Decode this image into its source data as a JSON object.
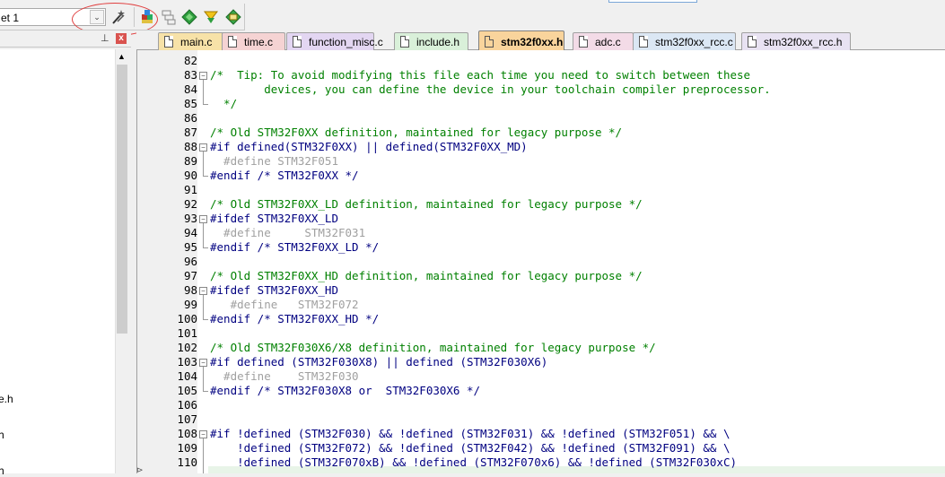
{
  "toolbar": {
    "target_name": "et 1",
    "target_dropdown": "⌄",
    "buttons": [
      {
        "name": "target-options-icon"
      },
      {
        "name": "manage-project-items-icon"
      },
      {
        "name": "batch-build-icon"
      },
      {
        "name": "select-packs-icon"
      },
      {
        "name": "pack-installer-icon"
      },
      {
        "name": "manage-run-time-environment-icon"
      }
    ]
  },
  "project_panel": {
    "pin": "⊥",
    "close": "x",
    "scroll_up": "▲",
    "items": [
      {
        "label": "e.h"
      },
      {
        "label": "h"
      },
      {
        "label": "h"
      }
    ]
  },
  "tabs": [
    {
      "label": "main.c",
      "color": "#f7e2a8",
      "active": false
    },
    {
      "label": "time.c",
      "color": "#f5d3d3",
      "active": false
    },
    {
      "label": "function_misc.c",
      "color": "#e3d6f2",
      "active": false
    },
    {
      "label": "include.h",
      "color": "#d9f0d9",
      "active": false
    },
    {
      "label": "stm32f0xx.h",
      "color": "#f9d49c",
      "active": true
    },
    {
      "label": "adc.c",
      "color": "#f3dbe7",
      "active": false
    },
    {
      "label": "stm32f0xx_rcc.c",
      "color": "#dbe7f4",
      "active": false
    },
    {
      "label": "stm32f0xx_rcc.h",
      "color": "#e8e2f2",
      "active": false
    }
  ],
  "code": [
    {
      "n": "82",
      "t": "",
      "k": "text"
    },
    {
      "n": "83",
      "t": "/*  Tip: To avoid modifying this file each time you need to switch between these",
      "k": "comment",
      "fold": "open"
    },
    {
      "n": "84",
      "t": "        devices, you can define the device in your toolchain compiler preprocessor.",
      "k": "comment"
    },
    {
      "n": "85",
      "t": "  */",
      "k": "comment",
      "fold": "end"
    },
    {
      "n": "86",
      "t": "",
      "k": "text"
    },
    {
      "n": "87",
      "t": "/* Old STM32F0XX definition, maintained for legacy purpose */",
      "k": "comment"
    },
    {
      "n": "88",
      "t": "#if defined(STM32F0XX) || defined(STM32F0XX_MD)",
      "k": "pp",
      "fold": "open"
    },
    {
      "n": "89",
      "t": "  #define STM32F051",
      "k": "dim"
    },
    {
      "n": "90",
      "t": "#endif /* STM32F0XX */",
      "k": "pp",
      "fold": "end"
    },
    {
      "n": "91",
      "t": "",
      "k": "text"
    },
    {
      "n": "92",
      "t": "/* Old STM32F0XX_LD definition, maintained for legacy purpose */",
      "k": "comment"
    },
    {
      "n": "93",
      "t": "#ifdef STM32F0XX_LD",
      "k": "pp",
      "fold": "open"
    },
    {
      "n": "94",
      "t": "  #define     STM32F031",
      "k": "dim"
    },
    {
      "n": "95",
      "t": "#endif /* STM32F0XX_LD */",
      "k": "pp",
      "fold": "end"
    },
    {
      "n": "96",
      "t": "",
      "k": "text"
    },
    {
      "n": "97",
      "t": "/* Old STM32F0XX_HD definition, maintained for legacy purpose */",
      "k": "comment"
    },
    {
      "n": "98",
      "t": "#ifdef STM32F0XX_HD",
      "k": "pp",
      "fold": "open"
    },
    {
      "n": "99",
      "t": "   #define   STM32F072",
      "k": "dim"
    },
    {
      "n": "100",
      "t": "#endif /* STM32F0XX_HD */",
      "k": "pp",
      "fold": "end"
    },
    {
      "n": "101",
      "t": "",
      "k": "text"
    },
    {
      "n": "102",
      "t": "/* Old STM32F030X6/X8 definition, maintained for legacy purpose */",
      "k": "comment"
    },
    {
      "n": "103",
      "t": "#if defined (STM32F030X8) || defined (STM32F030X6)",
      "k": "pp",
      "fold": "open"
    },
    {
      "n": "104",
      "t": "  #define    STM32F030",
      "k": "dim"
    },
    {
      "n": "105",
      "t": "#endif /* STM32F030X8 or  STM32F030X6 */",
      "k": "pp",
      "fold": "end"
    },
    {
      "n": "106",
      "t": "",
      "k": "text"
    },
    {
      "n": "107",
      "t": "",
      "k": "text"
    },
    {
      "n": "108",
      "t": "#if !defined (STM32F030) && !defined (STM32F031) && !defined (STM32F051) && \\",
      "k": "pp",
      "fold": "open"
    },
    {
      "n": "109",
      "t": "    !defined (STM32F072) && !defined (STM32F042) && !defined (STM32F091) && \\",
      "k": "pp"
    },
    {
      "n": "110",
      "t": "    !defined (STM32F070xB) && !defined (STM32F070x6) && !defined (STM32F030xC)",
      "k": "pp"
    }
  ]
}
